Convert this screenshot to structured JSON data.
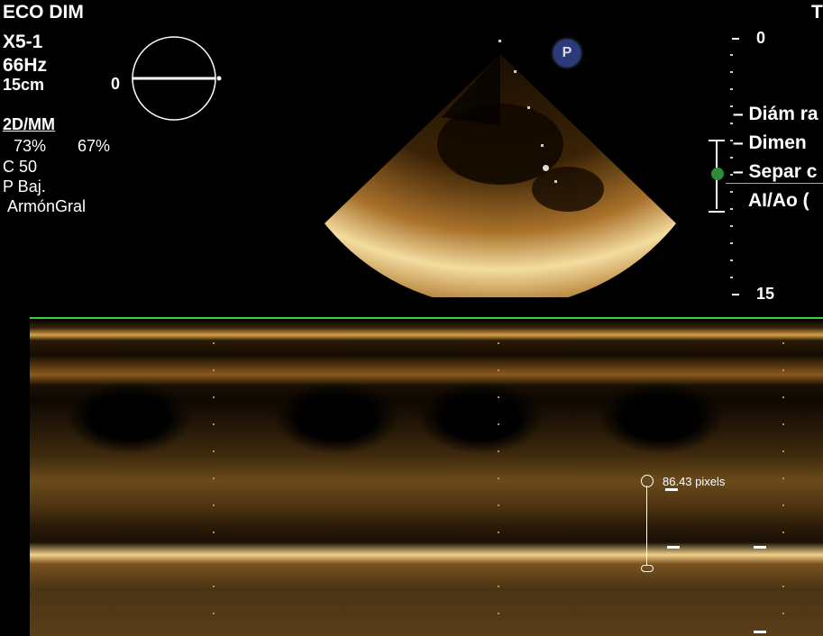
{
  "header": {
    "title": "ECO DIM",
    "probe": "X5-1",
    "frame_rate": "66Hz",
    "depth": "15cm",
    "right_cut": "T"
  },
  "settings": {
    "mode": "2D/MM",
    "gain_2d": "73%",
    "gain_mm": "67%",
    "compress": "C 50",
    "power": "P Baj.",
    "harmonic": "ArmónGral"
  },
  "orientation": {
    "label": "0"
  },
  "depth_scale": {
    "top": "0",
    "bottom": "15"
  },
  "measurements": {
    "items": [
      "Diám ra",
      "Dimen",
      "Separ c",
      "AI/Ao ("
    ]
  },
  "caliper": {
    "readout": "86.43 pixels"
  },
  "marker": {
    "label": "P"
  },
  "colors": {
    "accent_green": "#3ecf3e",
    "image_tint": "#e0a040"
  }
}
